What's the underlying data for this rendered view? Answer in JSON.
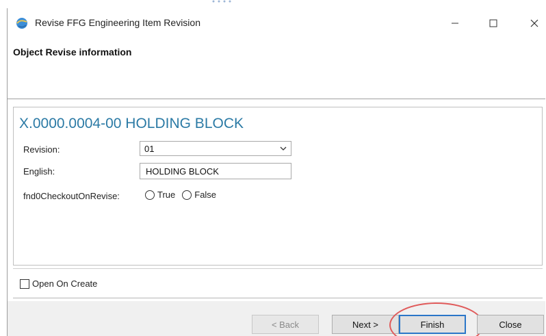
{
  "window": {
    "title": "Revise FFG Engineering Item Revision",
    "controls": {
      "minimize_icon": "minimize-icon",
      "maximize_icon": "maximize-icon",
      "close_icon": "close-icon"
    }
  },
  "header": {
    "title": "Object Revise information"
  },
  "object": {
    "title": "X.0000.0004-00 HOLDING BLOCK"
  },
  "form": {
    "revision": {
      "label": "Revision:",
      "value": "01"
    },
    "english": {
      "label": "English:",
      "value": "HOLDING BLOCK"
    },
    "checkout": {
      "label": "fnd0CheckoutOnRevise:",
      "options": [
        "True",
        "False"
      ]
    }
  },
  "footer": {
    "open_on_create_label": "Open On Create"
  },
  "buttons": {
    "back": "< Back",
    "next": "Next >",
    "finish": "Finish",
    "close": "Close"
  },
  "colors": {
    "accent_title": "#2b7aa5",
    "finish_focus": "#2a76c8",
    "highlight": "#e05a5a"
  }
}
